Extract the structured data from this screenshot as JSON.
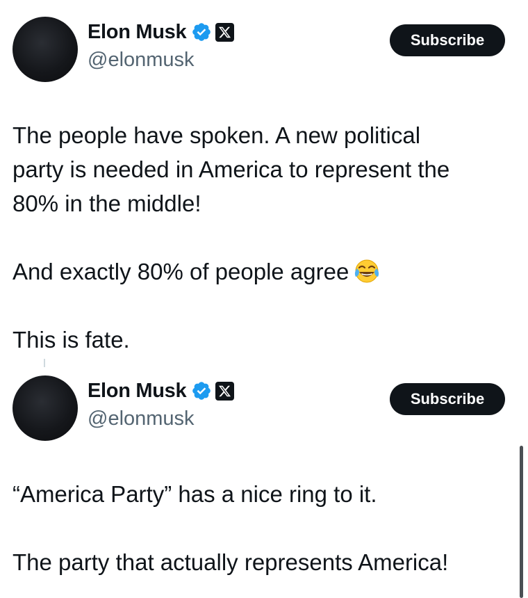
{
  "posts": [
    {
      "author": {
        "name": "Elon Musk",
        "handle": "@elonmusk",
        "verified_icon": "verified-badge-icon",
        "affiliation_icon": "x-logo-icon"
      },
      "subscribe_label": "Subscribe",
      "text": {
        "p1_line1": "The people have spoken. A new political",
        "p1_line2": "party is needed in America to represent the",
        "p1_line3": "80% in the middle!",
        "p2": "And exactly 80% of people agree",
        "p2_emoji": "face-with-tears-of-joy-icon",
        "p3": "This is fate."
      }
    },
    {
      "author": {
        "name": "Elon Musk",
        "handle": "@elonmusk",
        "verified_icon": "verified-badge-icon",
        "affiliation_icon": "x-logo-icon"
      },
      "subscribe_label": "Subscribe",
      "text": {
        "p1": "“America Party” has a nice ring to it.",
        "p2": "The party that actually represents America!"
      }
    }
  ],
  "colors": {
    "text_primary": "#0f1419",
    "text_secondary": "#536471",
    "verified_blue": "#1d9bf0",
    "button_bg": "#0f1419",
    "button_text": "#ffffff"
  }
}
